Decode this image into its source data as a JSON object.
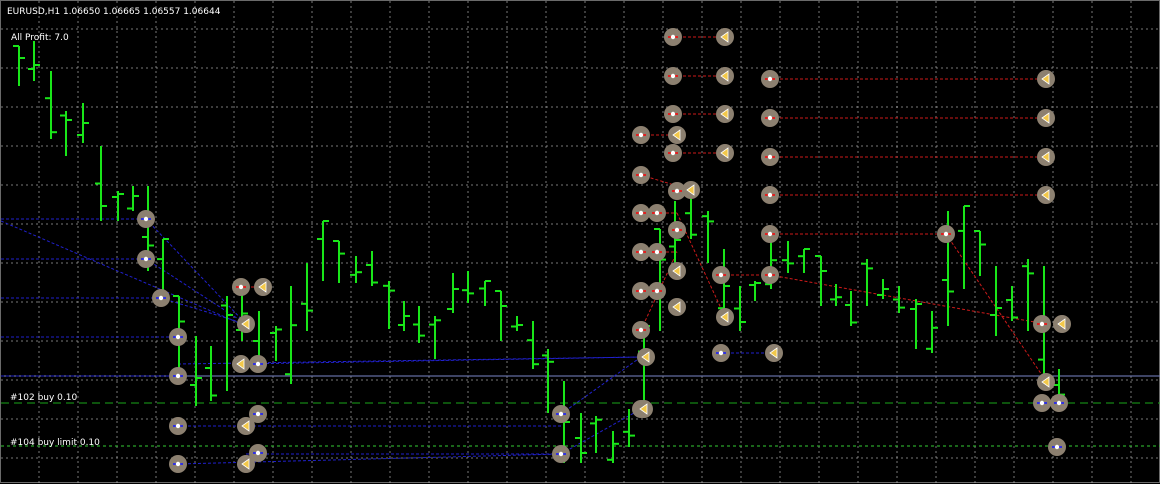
{
  "chart": {
    "symbol_line": "EURUSD,H1  1.06650 1.06665 1.06557 1.06644",
    "profit_label": "All Profit: 7.0",
    "bg_color": "#000000",
    "grid_color": "#b9b9b9",
    "bar_color": "#19e619",
    "buy_color": "#2020cc",
    "sell_color": "#cc1a1a"
  },
  "orders": [
    {
      "label": "#102 buy 0.10",
      "line_color": "#1aa61a"
    },
    {
      "label": "#104 buy limit 0.10",
      "line_color": "#33cc33"
    }
  ]
}
